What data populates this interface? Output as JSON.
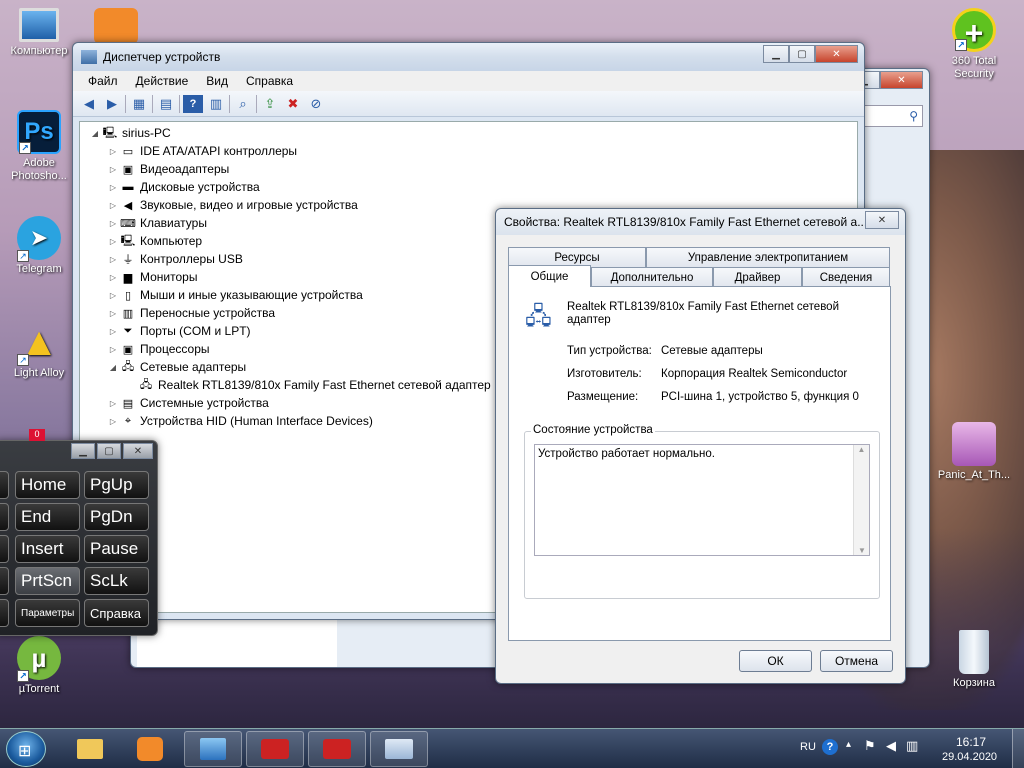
{
  "desktop": {
    "icons_left": [
      {
        "label": "Компьютер"
      },
      {
        "label": "Adobe Photosho..."
      },
      {
        "label": "Telegram"
      },
      {
        "label": "Light Alloy"
      },
      {
        "label": "µTorrent"
      }
    ],
    "icons_right": [
      {
        "label": "360 Total Security"
      },
      {
        "label": "Panic_At_Th..."
      },
      {
        "label": "Корзина"
      }
    ]
  },
  "devmgr": {
    "title": "Диспетчер устройств",
    "menu": [
      "Файл",
      "Действие",
      "Вид",
      "Справка"
    ],
    "root": "sirius-PC",
    "categories": [
      "IDE ATA/ATAPI контроллеры",
      "Видеоадаптеры",
      "Дисковые устройства",
      "Звуковые, видео и игровые устройства",
      "Клавиатуры",
      "Компьютер",
      "Контроллеры USB",
      "Мониторы",
      "Мыши и иные указывающие устройства",
      "Переносные устройства",
      "Порты (COM и LPT)",
      "Процессоры",
      "Сетевые адаптеры",
      "Системные устройства",
      "Устройства HID (Human Interface Devices)"
    ],
    "network_child": "Realtek RTL8139/810x Family Fast Ethernet сетевой адаптер"
  },
  "props": {
    "title": "Свойства: Realtek RTL8139/810x Family Fast Ethernet сетевой а...",
    "tabs_row1": [
      "Ресурсы",
      "Управление электропитанием"
    ],
    "tabs_row2": [
      "Общие",
      "Дополнительно",
      "Драйвер",
      "Сведения"
    ],
    "device_name": "Realtek RTL8139/810x Family Fast Ethernet сетевой адаптер",
    "type_label": "Тип устройства:",
    "type_value": "Сетевые адаптеры",
    "maker_label": "Изготовитель:",
    "maker_value": "Корпорация Realtek Semiconductor",
    "location_label": "Размещение:",
    "location_value": "PCI-шина 1, устройство 5, функция 0",
    "status_group": "Состояние устройства",
    "status_text": "Устройство работает нормально.",
    "ok": "ОК",
    "cancel": "Отмена"
  },
  "keyboard": {
    "keys": [
      [
        "Home",
        "PgUp"
      ],
      [
        "End",
        "PgDn"
      ],
      [
        "Insert",
        "Pause"
      ],
      [
        "PrtScn",
        "ScLk"
      ],
      [
        "Параметры",
        "Справка"
      ]
    ]
  },
  "tray": {
    "lang": "RU",
    "time": "16:17",
    "date": "29.04.2020"
  }
}
